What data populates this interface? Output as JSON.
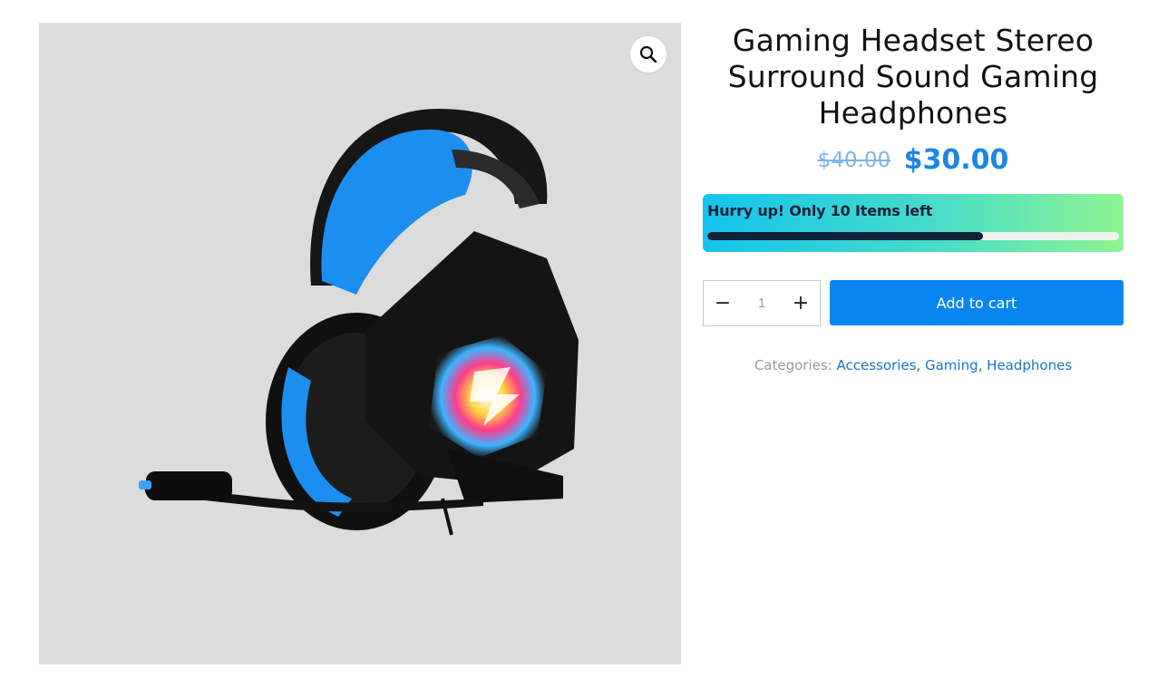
{
  "product": {
    "title": "Gaming Headset Stereo Surround Sound Gaming Headphones",
    "price_old": "$40.00",
    "price_new": "$30.00",
    "image_alt": "Blue and black gaming headset with RGB-lit ear cup and boom microphone"
  },
  "gallery": {
    "zoom_icon": "magnifier-icon",
    "background": "#dcdcdc"
  },
  "stock": {
    "message": "Hurry up! Only 10 Items left",
    "progress_fraction": 0.67
  },
  "cart": {
    "quantity": "1",
    "minus_label": "−",
    "plus_label": "+",
    "add_label": "Add to cart"
  },
  "categories": {
    "label": "Categories:",
    "items": [
      "Accessories",
      "Gaming",
      "Headphones"
    ],
    "separator": ","
  },
  "colors": {
    "accent": "#0786f0",
    "price": "#1a86e6",
    "gradient_start": "#14c3ee",
    "gradient_end": "#8ef592"
  }
}
